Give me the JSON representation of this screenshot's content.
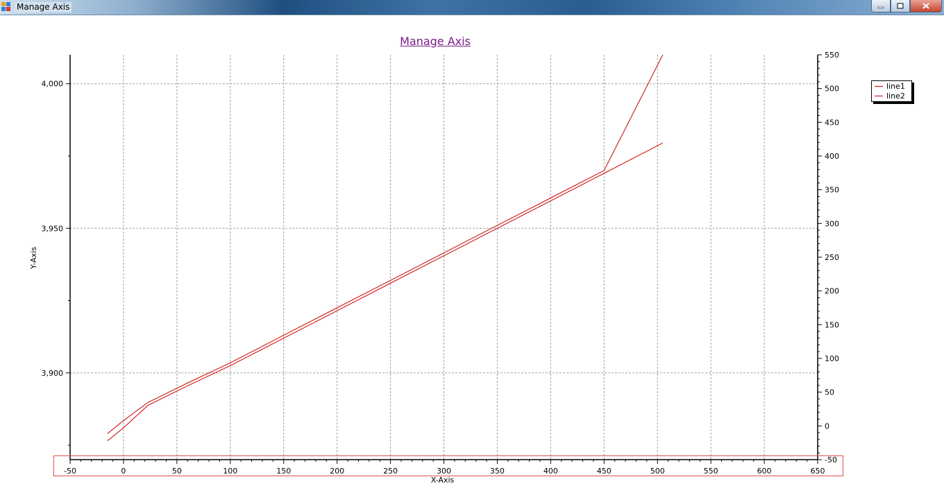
{
  "window": {
    "title": "Manage Axis",
    "minimize_icon": "minimize-icon",
    "restore_icon": "restore-icon",
    "close_icon": "close-icon"
  },
  "colors": {
    "series": "#cc0000",
    "title": "#7a1b8a",
    "grid": "#a0a0a0",
    "highlight": "#e04a4a"
  },
  "chart_data": {
    "type": "line",
    "title": "Manage Axis",
    "xlabel": "X-Axis",
    "ylabel": "Y-Axis",
    "xlim": [
      -50,
      650
    ],
    "ylim": [
      3870,
      4010
    ],
    "y2lim": [
      -50,
      550
    ],
    "x_ticks": [
      -50,
      0,
      50,
      100,
      150,
      200,
      250,
      300,
      350,
      400,
      450,
      500,
      550,
      600,
      650
    ],
    "y_ticks": [
      3900,
      3950,
      4000
    ],
    "y_tick_labels": [
      "3,900",
      "3,950",
      "4,000"
    ],
    "y2_ticks": [
      -50,
      0,
      50,
      100,
      150,
      200,
      250,
      300,
      350,
      400,
      450,
      500,
      550
    ],
    "grid": true,
    "legend_position": "top-right outside",
    "series": [
      {
        "name": "line1",
        "color": "#cc0000",
        "x": [
          -15,
          0,
          23,
          60,
          100,
          150,
          200,
          250,
          300,
          350,
          400,
          450,
          505
        ],
        "y": [
          3876.5,
          3881,
          3888.8,
          3895.5,
          3902.5,
          3912,
          3921.5,
          3931,
          3940.5,
          3950,
          3959.5,
          3969,
          3979.5
        ]
      },
      {
        "name": "line2",
        "color": "#cc0000",
        "x": [
          -15,
          0,
          23,
          60,
          100,
          150,
          200,
          250,
          300,
          350,
          400,
          450,
          505
        ],
        "y": [
          3879,
          3883.5,
          3889.8,
          3896.5,
          3903.5,
          3913,
          3922.5,
          3932,
          3941.5,
          3951,
          3960.5,
          3970,
          4010
        ]
      }
    ]
  }
}
